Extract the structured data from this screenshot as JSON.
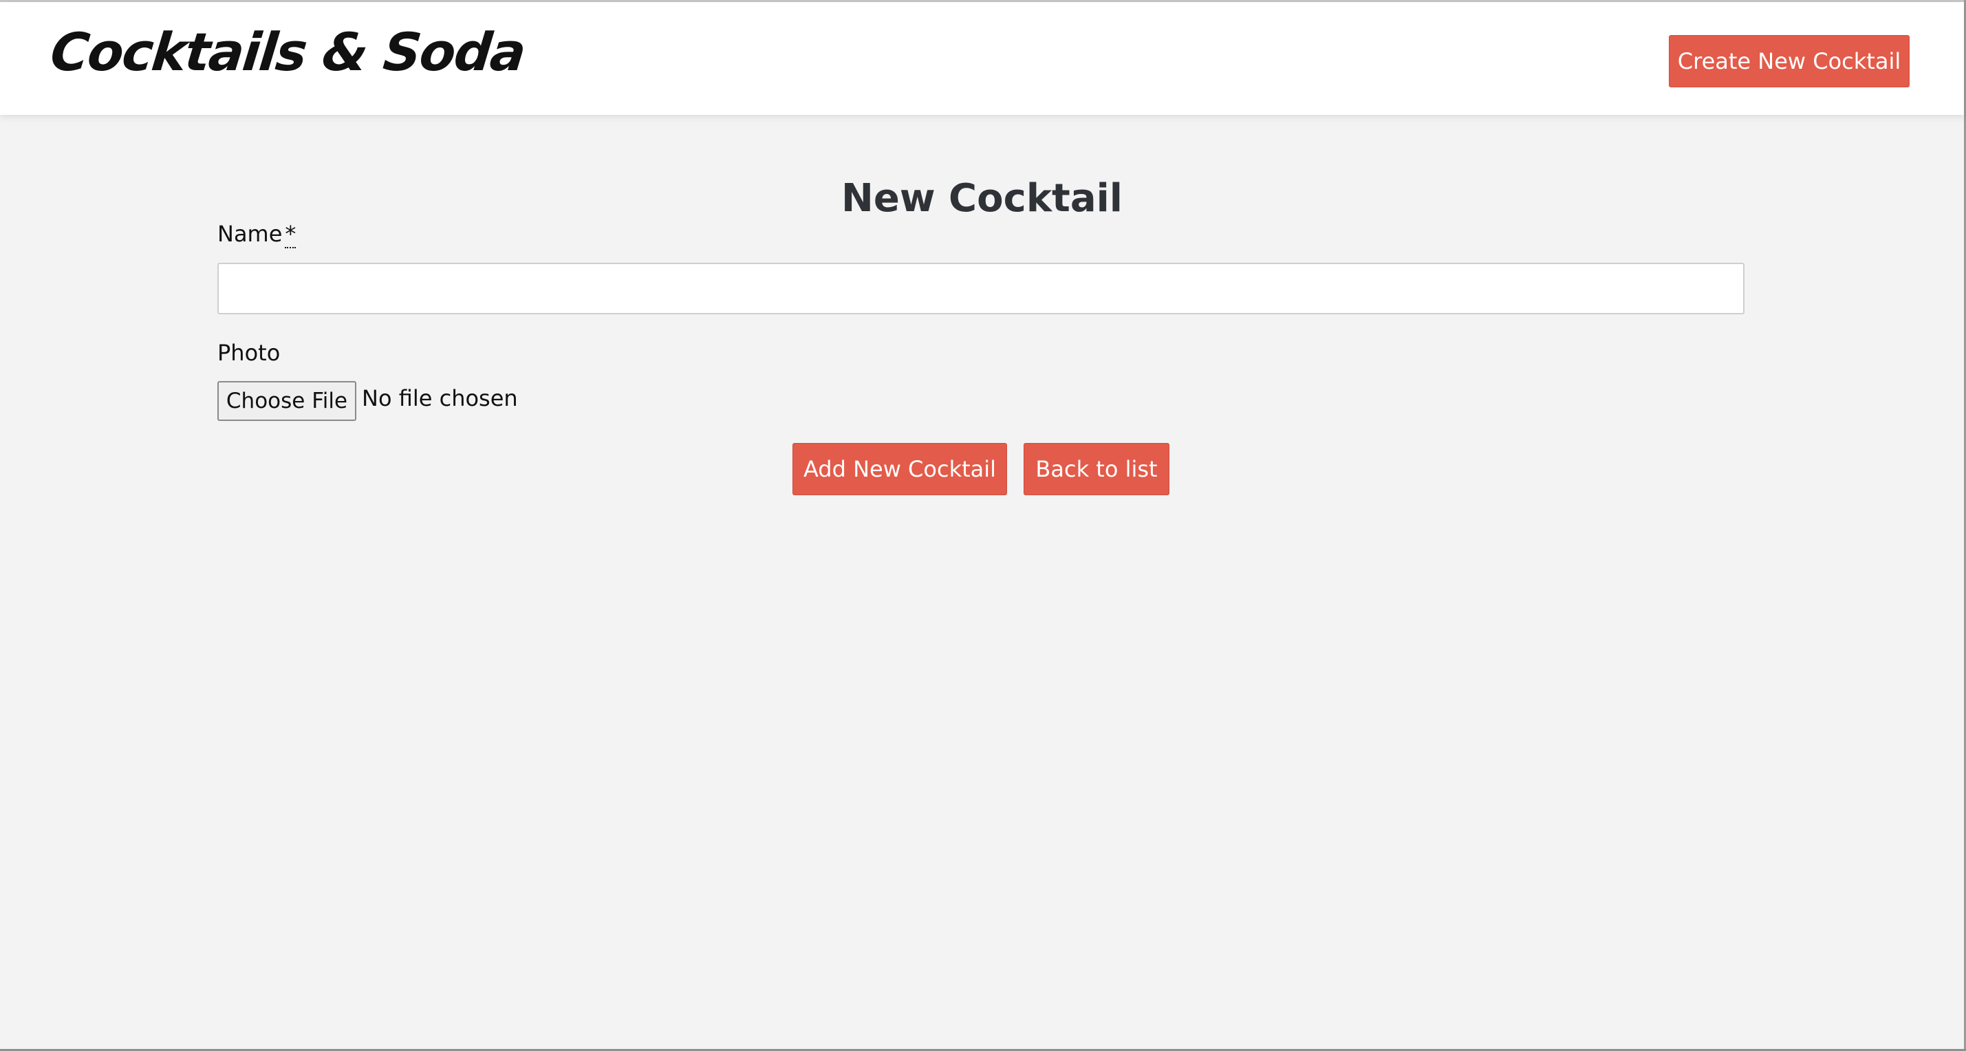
{
  "header": {
    "brand": "Cocktails & Soda",
    "create_button_label": "Create New Cocktail"
  },
  "form": {
    "title": "New Cocktail",
    "name_label": "Name",
    "required_marker": "*",
    "name_value": "",
    "photo_label": "Photo",
    "file_button_label": "Choose File",
    "file_status": "No file chosen",
    "submit_label": "Add New Cocktail",
    "back_label": "Back to list"
  },
  "colors": {
    "accent": "#e35b4a",
    "background": "#f3f3f3",
    "header_background": "#ffffff"
  }
}
